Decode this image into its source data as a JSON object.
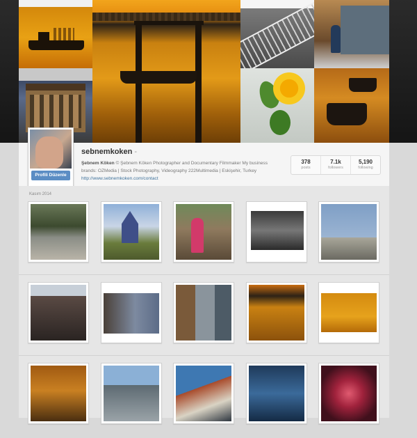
{
  "profile": {
    "username": "sebnemkoken",
    "username_dash": "-",
    "edit_button": "Profili Düzenle",
    "bio_name": "Şebnem Köken",
    "bio_text": " © Şebnem Köken Photographer and Documentary Filmmaker My business brands: OZMedia | Stock Photography, Videography 222Multimedia | Eskişehir, Turkey ",
    "bio_link": "http://www.sebnemkoken.com/contact"
  },
  "stats": [
    {
      "value": "378",
      "label": "posts"
    },
    {
      "value": "7.1k",
      "label": "followers"
    },
    {
      "value": "5,190",
      "label": "following"
    }
  ],
  "feed": {
    "month_label": "Kasım 2014"
  },
  "cover_photos": [
    "sunset-ship",
    "wooden-house",
    "pier-sunset",
    "railway",
    "sunflower",
    "woman-walking",
    "boats-sunset"
  ],
  "grid_photos": [
    "river-reeds",
    "castle",
    "girl-with-wood",
    "old-shop-bw",
    "man-on-roof",
    "friends-selfie",
    "two-men",
    "woman-on-street",
    "pier-sunset",
    "ship-sunset",
    "boats-sunset",
    "city-skyline",
    "red-building",
    "harbor-boats",
    "red-flower"
  ],
  "colors": {
    "link": "#3f729b",
    "edit_button": "#5b8dc4",
    "background": "#d9d9d9"
  }
}
